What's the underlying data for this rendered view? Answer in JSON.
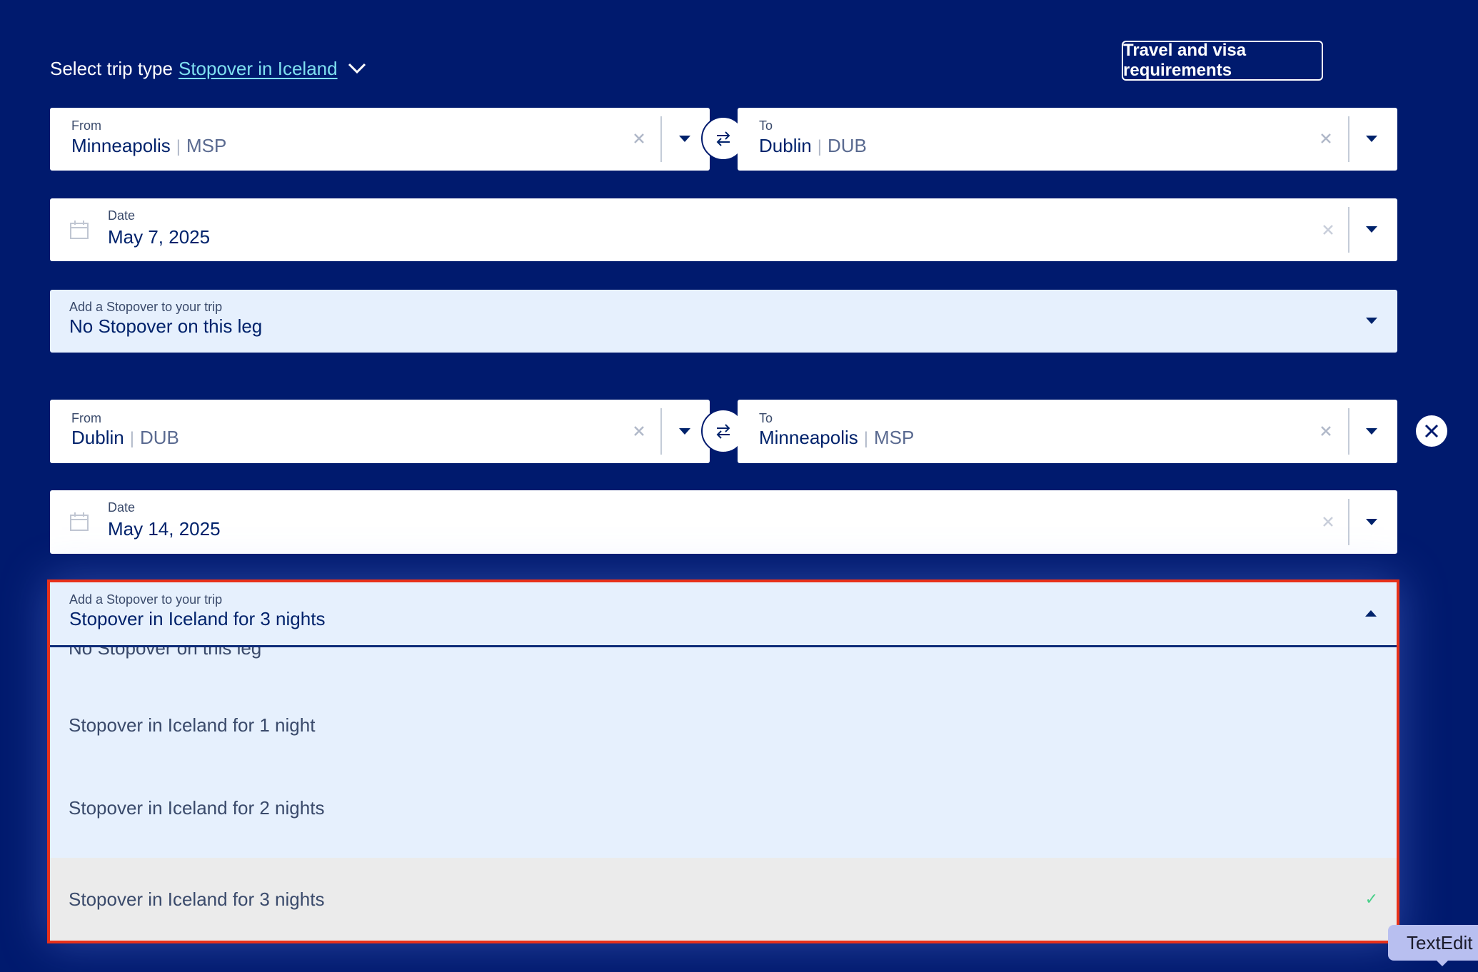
{
  "header": {
    "trip_type_label": "Select trip type",
    "trip_type_value": "Stopover in Iceland",
    "visa_button": "Travel and visa requirements"
  },
  "leg1": {
    "from_label": "From",
    "from_city": "Minneapolis",
    "from_code": "MSP",
    "to_label": "To",
    "to_city": "Dublin",
    "to_code": "DUB",
    "date_label": "Date",
    "date_value": "May 7, 2025",
    "stopover_label": "Add a Stopover to your trip",
    "stopover_value": "No Stopover on this leg"
  },
  "leg2": {
    "from_label": "From",
    "from_city": "Dublin",
    "from_code": "DUB",
    "to_label": "To",
    "to_city": "Minneapolis",
    "to_code": "MSP",
    "date_label": "Date",
    "date_value": "May 14, 2025",
    "stopover_label": "Add a Stopover to your trip",
    "stopover_value": "Stopover in Iceland for 3 nights"
  },
  "dropdown": {
    "options": [
      "No Stopover on this leg",
      "Stopover in Iceland for 1 night",
      "Stopover in Iceland for 2 nights",
      "Stopover in Iceland for 3 nights"
    ],
    "selected_index": 3,
    "check_glyph": "✓"
  },
  "tooltip": {
    "text": "TextEdit"
  },
  "colors": {
    "background": "#001a6e",
    "link": "#7fe0f0",
    "highlight_border": "#e8311a",
    "light_field": "#e6f0fd",
    "check": "#4ad08a"
  },
  "icons": {
    "trip_chevron": "chevron-down-icon",
    "clear": "close-icon",
    "caret": "caret-down-icon",
    "swap": "swap-icon",
    "calendar": "calendar-icon",
    "remove_leg": "close-circle-icon",
    "check": "check-icon"
  }
}
